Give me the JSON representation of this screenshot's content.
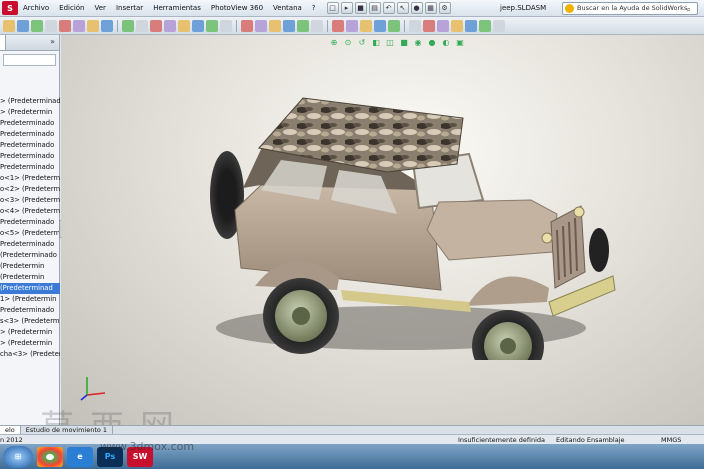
{
  "menubar": {
    "items": [
      "Archivo",
      "Edición",
      "Ver",
      "Insertar",
      "Herramientas",
      "PhotoView 360",
      "Ventana",
      "?"
    ],
    "doc_title": "jeep.SLDASM",
    "help_placeholder": "Buscar en la Ayuda de SolidWorks"
  },
  "panel": {
    "collapse_glyph": "»",
    "tree_rows": [
      "> (Predeterminad",
      "> (Predetermin",
      "Predeterminado",
      "Predeterminado",
      "Predeterminado",
      "Predeterminado",
      "Predeterminado",
      "o<1> (Predetermi",
      "o<2> (Predetermi",
      "o<3> (Predetermi",
      "o<4> (Predetermi",
      "Predeterminado",
      "o<5> (Predetermi",
      "Predeterminado",
      "(Predeterminado",
      "(Predetermin",
      "(Predetermin",
      "(Predeterminad",
      "1> (Predetermin",
      "Predeterminado",
      "s<3> (Predetermi",
      "> (Predetermin",
      "> (Predetermin",
      "cha<3> (Predetermi"
    ],
    "selected_index": 17
  },
  "bottom_tabs": [
    "elo",
    "Estudio de movimiento 1"
  ],
  "status": {
    "left": "n 2012",
    "defined": "Insuficientemente definida",
    "mode": "Editando Ensamblaje",
    "units": "MMGS"
  },
  "watermark": {
    "text": "www.3dmox.com",
    "cn": "莫西网"
  },
  "colors": {
    "accent": "#3b7ad6",
    "body": "#b29f8e",
    "camo": "#6e6458"
  }
}
